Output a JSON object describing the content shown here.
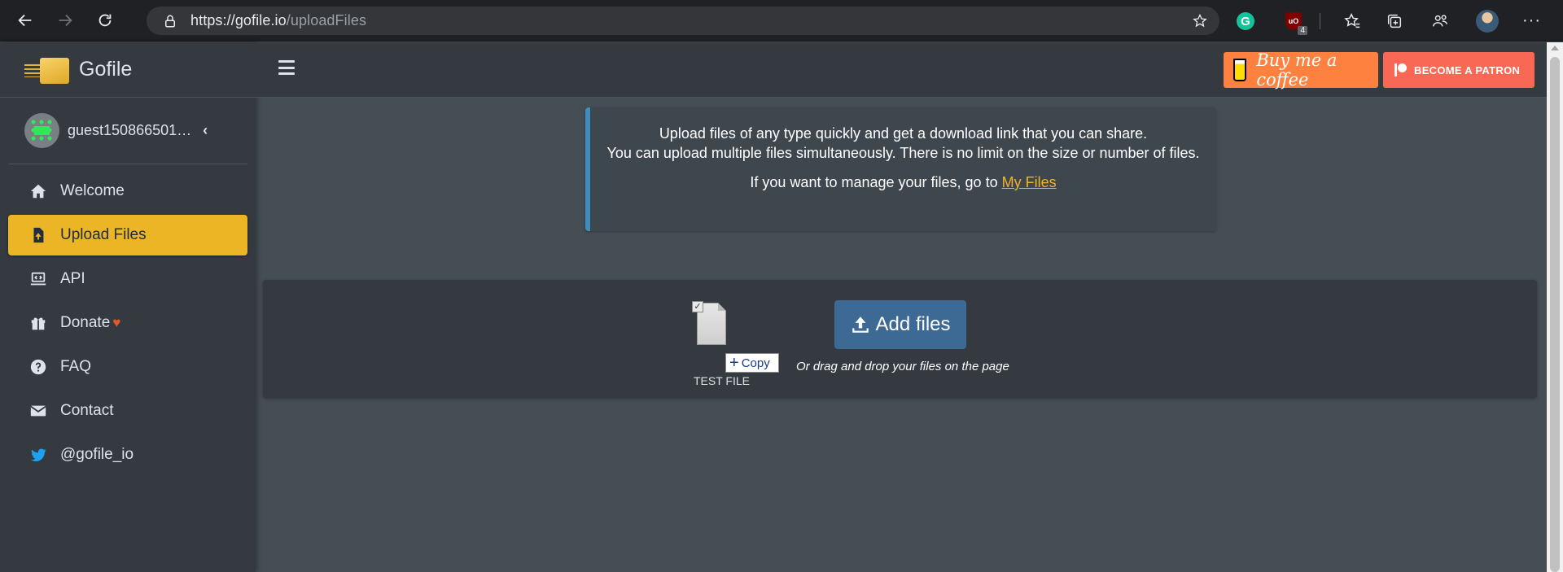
{
  "browser": {
    "url_host": "https://gofile.io",
    "url_path": "/uploadFiles",
    "ublock_count": "4",
    "ublock_label": "uO",
    "grammarly_letter": "G"
  },
  "sidebar": {
    "brand": "Gofile",
    "user_name": "guest150866501…",
    "items": [
      {
        "label": "Welcome",
        "icon": "home-icon"
      },
      {
        "label": "Upload Files",
        "icon": "file-upload-icon",
        "active": true
      },
      {
        "label": "API",
        "icon": "laptop-code-icon"
      },
      {
        "label": "Donate",
        "icon": "gift-icon"
      },
      {
        "label": "FAQ",
        "icon": "question-circle-icon"
      },
      {
        "label": "Contact",
        "icon": "envelope-icon"
      },
      {
        "label": "@gofile_io",
        "icon": "twitter-icon"
      }
    ],
    "donate_heart": "♥"
  },
  "topbar": {
    "coffee_label": "Buy me a coffee",
    "patron_label": "BECOME A PATRON"
  },
  "info": {
    "line1": "Upload files of any type quickly and get a download link that you can share.",
    "line2": "You can upload multiple files simultaneously. There is no limit on the size or number of files.",
    "line3_prefix": "If you want to manage your files, go to ",
    "line3_link": "My Files"
  },
  "upload": {
    "add_button": "Add files",
    "drop_hint": "Or drag and drop your files on the page",
    "dragged_file_name": "TEST FILE",
    "copy_tooltip": "Copy"
  },
  "colors": {
    "accent": "#ebb526",
    "sidebar_bg": "#343a40",
    "content_bg": "#454d55",
    "add_button_bg": "#3d6995",
    "callout_border": "#3c8dbc"
  }
}
